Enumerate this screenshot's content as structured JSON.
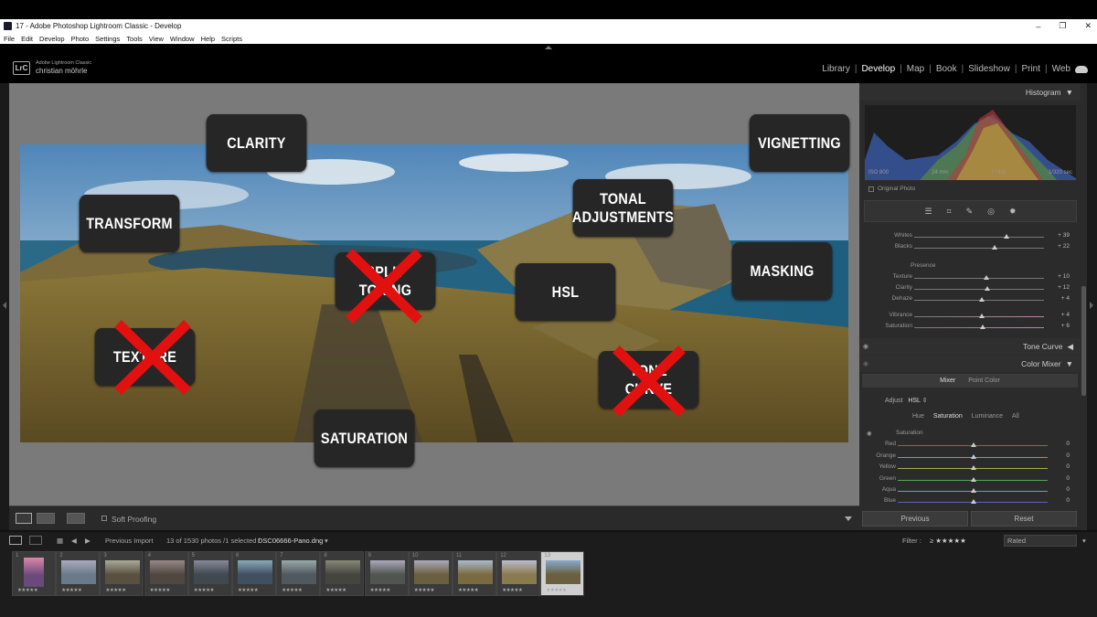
{
  "window": {
    "title": "17 - Adobe Photoshop Lightroom Classic - Develop",
    "controls": [
      "–",
      "❐",
      "✕"
    ]
  },
  "menu": [
    "File",
    "Edit",
    "Develop",
    "Photo",
    "Settings",
    "Tools",
    "View",
    "Window",
    "Help",
    "Scripts"
  ],
  "identity": {
    "badge": "LrC",
    "line1": "Adobe Lightroom Classic",
    "line2": "christian möhrle"
  },
  "modules": [
    "Library",
    "Develop",
    "Map",
    "Book",
    "Slideshow",
    "Print",
    "Web"
  ],
  "active_module": "Develop",
  "overlays": {
    "clarity": "CLARITY",
    "vignetting": "VIGNETTING",
    "transform": "TRANSFORM",
    "tonal_line1": "TONAL",
    "tonal_line2": "ADJUSTMENTS",
    "split_line1": "SPLIT",
    "split_line2": "TONING",
    "hsl": "HSL",
    "masking": "MASKING",
    "texture": "TEXTURE",
    "tone_line1": "TONE",
    "tone_line2": "CURVE",
    "saturation": "SATURATION"
  },
  "toolbar": {
    "soft_proofing": "Soft Proofing"
  },
  "panel": {
    "histogram_title": "Histogram",
    "exif": [
      "ISO 800",
      "24 mm",
      "f / 8.0",
      "1/320 sec"
    ],
    "original_photo": "Original Photo",
    "tools": [
      "☰",
      "⌗",
      "✎",
      "◎",
      "✹"
    ],
    "basic_sliders": [
      {
        "label": "Whites",
        "value": "+ 39",
        "pos": 0.7
      },
      {
        "label": "Blacks",
        "value": "+ 22",
        "pos": 0.61
      }
    ],
    "presence_label": "Presence",
    "presence_sliders": [
      {
        "label": "Texture",
        "value": "+ 10",
        "pos": 0.55
      },
      {
        "label": "Clarity",
        "value": "+ 12",
        "pos": 0.56
      },
      {
        "label": "Dehaze",
        "value": "+ 4",
        "pos": 0.52
      },
      {
        "label": "Vibrance",
        "value": "+ 4",
        "pos": 0.52
      },
      {
        "label": "Saturation",
        "value": "+ 6",
        "pos": 0.53
      }
    ],
    "tone_curve_title": "Tone Curve",
    "color_mixer_title": "Color Mixer",
    "cm_tabs": [
      "Mixer",
      "Point Color"
    ],
    "adjust_label": "Adjust",
    "adjust_value": "HSL",
    "hsl_tabs": [
      "Hue",
      "Saturation",
      "Luminance",
      "All"
    ],
    "saturation_label": "Saturation",
    "colors": [
      {
        "label": "Red",
        "value": "0",
        "color": "#b44"
      },
      {
        "label": "Orange",
        "value": "0",
        "color": "#c84"
      },
      {
        "label": "Yellow",
        "value": "0",
        "color": "#bb4"
      },
      {
        "label": "Green",
        "value": "0",
        "color": "#4a4"
      },
      {
        "label": "Aqua",
        "value": "0",
        "color": "#4aa"
      },
      {
        "label": "Blue",
        "value": "0",
        "color": "#46b"
      }
    ],
    "previous_button": "Previous",
    "reset_button": "Reset"
  },
  "filmstrip": {
    "previous_import": "Previous Import",
    "info": "13 of 1530 photos /1 selected /",
    "filename": "DSC06666-Pano.dng",
    "filter_label": "Filter :",
    "rated": "Rated",
    "thumbs": [
      {
        "n": "1",
        "c1": "#6a4a7a",
        "c2": "#d8a"
      },
      {
        "n": "2",
        "c1": "#6a7a8a",
        "c2": "#aab"
      },
      {
        "n": "3",
        "c1": "#5a5040",
        "c2": "#aa9"
      },
      {
        "n": "4",
        "c1": "#504840",
        "c2": "#988"
      },
      {
        "n": "5",
        "c1": "#404850",
        "c2": "#889"
      },
      {
        "n": "6",
        "c1": "#405060",
        "c2": "#8ab"
      },
      {
        "n": "7",
        "c1": "#505860",
        "c2": "#9aa"
      },
      {
        "n": "8",
        "c1": "#454540",
        "c2": "#887"
      },
      {
        "n": "9",
        "c1": "#505550",
        "c2": "#aab"
      },
      {
        "n": "10",
        "c1": "#6a6040",
        "c2": "#aab"
      },
      {
        "n": "11",
        "c1": "#7a6a40",
        "c2": "#abc"
      },
      {
        "n": "12",
        "c1": "#8a7a50",
        "c2": "#bbc"
      },
      {
        "n": "13",
        "c1": "#6a6040",
        "c2": "#8ac"
      }
    ],
    "stars": "★★★★★"
  }
}
